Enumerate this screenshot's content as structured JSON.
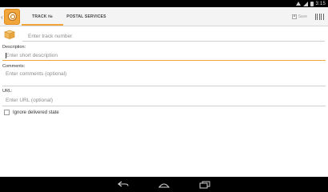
{
  "status_bar": {
    "time": "3:15",
    "icons": [
      "wifi-icon",
      "signal-icon",
      "battery-icon"
    ]
  },
  "action_bar": {
    "app_icon": "package-tracker-logo-icon",
    "tabs": [
      {
        "label": "TRACK №",
        "selected": true
      },
      {
        "label": "POSTAL SERVICES",
        "selected": false
      }
    ],
    "save_label": "Save",
    "barcode_icon": "barcode-icon",
    "accent_color": "#f0a63a"
  },
  "form": {
    "track_number": {
      "value": "",
      "placeholder": "Enter track number",
      "icon": "box-icon"
    },
    "description": {
      "label": "Description:",
      "value": "",
      "placeholder": "Enter short description"
    },
    "comments": {
      "label": "Comments:",
      "value": "",
      "placeholder": "Enter comments (optional)"
    },
    "url": {
      "label": "URL:",
      "value": "",
      "placeholder": "Enter URL (optional)"
    },
    "ignore_delivered": {
      "label": "Ignore delivered state",
      "checked": false
    }
  },
  "nav_bar": {
    "buttons": [
      "back-icon",
      "home-icon",
      "recents-icon"
    ]
  }
}
